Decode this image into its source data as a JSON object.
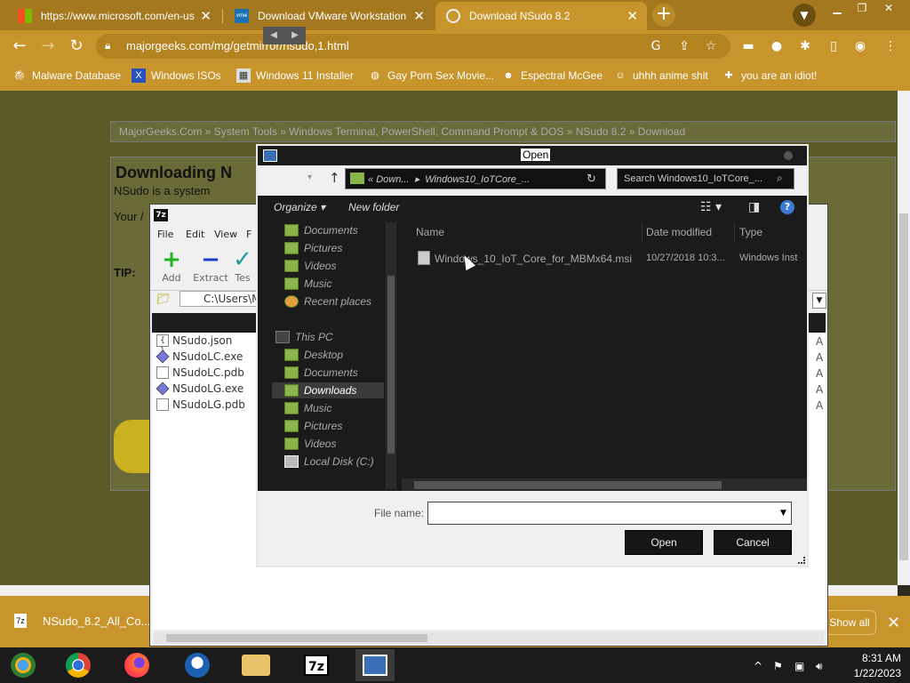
{
  "browser": {
    "tabs": [
      {
        "title": "https://www.microsoft.com/en-us"
      },
      {
        "title": "Download VMware Workstation Pl"
      },
      {
        "title": "Download NSudo 8.2"
      }
    ],
    "url": "majorgeeks.com/mg/getmirror/nsudo,1.html",
    "bookmarks": [
      {
        "label": "Malware Database"
      },
      {
        "label": "Windows ISOs"
      },
      {
        "label": "Windows 11 Installer"
      },
      {
        "label": "Gay Porn Sex Movie..."
      },
      {
        "label": "Espectral McGee"
      },
      {
        "label": "uhhh anime shit"
      },
      {
        "label": "you are an idiot!"
      }
    ],
    "accent_color": "#c8952c"
  },
  "page": {
    "breadcrumb": "MajorGeeks.Com » System Tools » Windows Terminal, PowerShell, Command Prompt & DOS » NSudo 8.2 » Download",
    "title": "Downloading N",
    "intro": "NSudo is a system",
    "your": "Your /",
    "tip": "TIP:"
  },
  "download_shelf": {
    "file": "NSudo_8.2_All_Co...",
    "show_all": "Show all"
  },
  "sevenzip": {
    "menu": [
      "File",
      "Edit",
      "View",
      "F"
    ],
    "tools": [
      {
        "label": "Add",
        "icon": "+"
      },
      {
        "label": "Extract",
        "icon": "−"
      },
      {
        "label": "Tes",
        "icon": "✓"
      }
    ],
    "path": "C:\\Users\\M",
    "files": [
      {
        "name": "NSudo.json",
        "attr": "A"
      },
      {
        "name": "NSudoLC.exe",
        "attr": "A"
      },
      {
        "name": "NSudoLC.pdb",
        "attr": "A"
      },
      {
        "name": "NSudoLG.exe",
        "attr": "A"
      },
      {
        "name": "NSudoLG.pdb",
        "attr": "A"
      }
    ]
  },
  "dialog": {
    "title": "Open",
    "path_prefix": "«",
    "path_1": "Down...",
    "path_2": "Windows10_IoTCore_...",
    "search_placeholder": "Search Windows10_IoTCore_...",
    "organize": "Organize",
    "new_folder": "New folder",
    "nav": {
      "quick": [
        "Documents",
        "Pictures",
        "Videos",
        "Music",
        "Recent places"
      ],
      "this_pc": "This PC",
      "pc_items": [
        "Desktop",
        "Documents",
        "Downloads",
        "Music",
        "Pictures",
        "Videos",
        "Local Disk (C:)"
      ]
    },
    "columns": {
      "name": "Name",
      "date": "Date modified",
      "type": "Type"
    },
    "file": {
      "name": "Windows_10_IoT_Core_for_MBMx64.msi",
      "date": "10/27/2018 10:3...",
      "type": "Windows Inst"
    },
    "file_name_label": "File name:",
    "file_name_value": "",
    "open": "Open",
    "cancel": "Cancel"
  },
  "taskbar": {
    "time": "8:31 AM",
    "date": "1/22/2023",
    "zip_label": "7z"
  }
}
